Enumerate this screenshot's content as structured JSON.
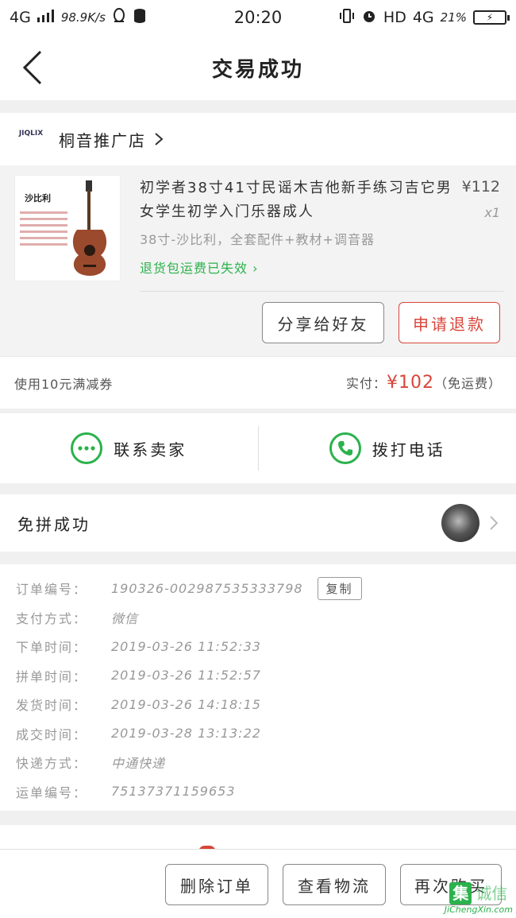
{
  "status_bar": {
    "network": "4G",
    "speed": "98.9K/s",
    "time": "20:20",
    "hd": "HD",
    "network_right": "4G",
    "battery": "21%"
  },
  "nav": {
    "title": "交易成功",
    "back_icon": "chevron-left-icon"
  },
  "shop": {
    "logo_text": "JIQLIX",
    "name": "桐音推广店",
    "chevron": "›"
  },
  "product": {
    "image_label": "沙比利",
    "title": "初学者38寸41寸民谣木吉他新手练习吉它男女学生初学入门乐器成人",
    "price": "¥112",
    "qty": "x1",
    "spec": "38寸-沙比利，全套配件+教材+调音器",
    "notice": "退货包运费已失效"
  },
  "actions": {
    "share": "分享给好友",
    "refund": "申请退款"
  },
  "payment": {
    "coupon": "使用10元满减券",
    "paid_label": "实付：",
    "paid_amount": "¥102",
    "shipping_note": "（免运费）"
  },
  "contact": {
    "seller": "联系卖家",
    "phone": "拨打电话"
  },
  "group": {
    "label": "免拼成功"
  },
  "order_info": [
    {
      "label": "订单编号：",
      "value": "190326-002987535333798",
      "copy": "复制"
    },
    {
      "label": "支付方式：",
      "value": "微信"
    },
    {
      "label": "下单时间：",
      "value": "2019-03-26 11:52:33"
    },
    {
      "label": "拼单时间：",
      "value": "2019-03-26 11:52:57"
    },
    {
      "label": "发货时间：",
      "value": "2019-03-26 14:18:15"
    },
    {
      "label": "成交时间：",
      "value": "2019-03-28 13:13:22"
    },
    {
      "label": "快递方式：",
      "value": "中通快递"
    },
    {
      "label": "运单编号：",
      "value": "75137371159653"
    }
  ],
  "bottom": {
    "delete": "删除订单",
    "logistics": "查看物流",
    "rebuy": "再次购买"
  },
  "watermark": {
    "badge": "集",
    "name": "诚信",
    "url": "JiChengXin.com"
  },
  "colors": {
    "accent_red": "#d8453a",
    "accent_green": "#2bb24c"
  }
}
